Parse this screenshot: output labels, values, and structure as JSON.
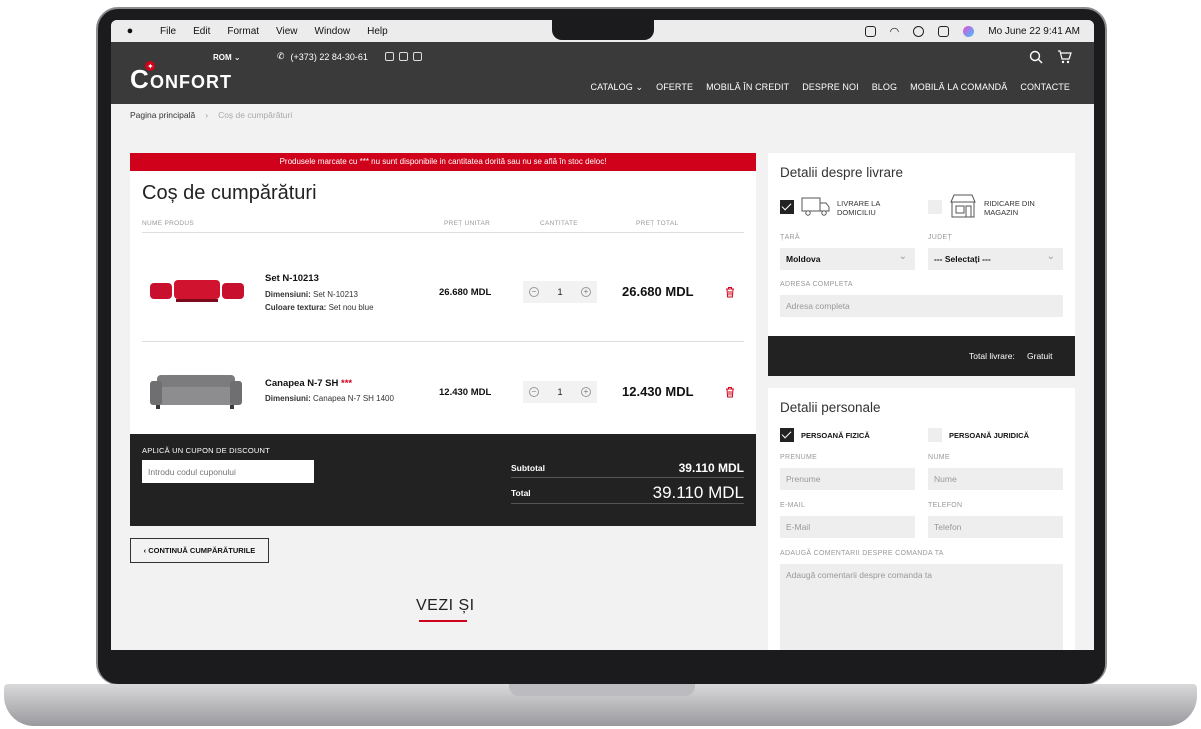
{
  "menubar": {
    "menus": [
      "File",
      "Edit",
      "Format",
      "View",
      "Window",
      "Help"
    ],
    "clock": "Mo June 22  9:41 AM"
  },
  "header": {
    "language": "ROM",
    "logo_text": "CONFORT",
    "phone": "(+373) 22 84-30-61",
    "nav": [
      "CATALOG",
      "OFERTE",
      "MOBILĂ ÎN CREDIT",
      "DESPRE NOI",
      "BLOG",
      "MOBILĂ LA COMANDĂ",
      "CONTACTE"
    ]
  },
  "breadcrumb": {
    "home": "Pagina principală",
    "current": "Coș de cumpărături"
  },
  "cart": {
    "alert": "Produsele marcate cu *** nu sunt disponibile in cantitatea dorită sau nu se află în stoc deloc!",
    "title": "Coș de cumpărături",
    "columns": {
      "product": "NUME PRODUS",
      "unit_price": "PREȚ UNITAR",
      "quantity": "CANTITATE",
      "total_price": "PREȚ TOTAL"
    },
    "items": [
      {
        "name": "Set N-10213",
        "stars": "",
        "dimensions_label": "Dimensiuni:",
        "dimensions": "Set N-10213",
        "color_label": "Culoare textura:",
        "color": "Set nou blue",
        "unit_price": "26.680 MDL",
        "quantity": "1",
        "total": "26.680 MDL"
      },
      {
        "name": "Canapea N-7 SH",
        "stars": "***",
        "dimensions_label": "Dimensiuni:",
        "dimensions": "Canapea N-7 SH 1400",
        "unit_price": "12.430 MDL",
        "quantity": "1",
        "total": "12.430 MDL"
      }
    ],
    "coupon_label": "APLICĂ UN CUPON DE DISCOUNT",
    "coupon_placeholder": "Introdu codul cuponului",
    "subtotal_label": "Subtotal",
    "subtotal": "39.110 MDL",
    "total_label": "Total",
    "total": "39.110 MDL",
    "continue_label": "‹ CONTINUĂ CUMPĂRĂTURILE",
    "see_also": "VEZI ȘI"
  },
  "delivery": {
    "title": "Detalii despre livrare",
    "home_delivery": "LIVRARE LA DOMICILIU",
    "pickup": "RIDICARE DIN MAGAZIN",
    "country_label": "ȚARĂ",
    "country_value": "Moldova",
    "district_label": "JUDEȚ",
    "district_value": "--- Selectați ---",
    "address_label": "ADRESA COMPLETA",
    "address_placeholder": "Adresa completa",
    "total_label": "Total livrare:",
    "total_value": "Gratuit"
  },
  "personal": {
    "title": "Detalii personale",
    "individual": "PERSOANĂ FIZICĂ",
    "legal": "PERSOANĂ JURIDICĂ",
    "firstname_label": "PRENUME",
    "firstname_placeholder": "Prenume",
    "lastname_label": "NUME",
    "lastname_placeholder": "Nume",
    "email_label": "E-MAIL",
    "email_placeholder": "E-Mail",
    "phone_label": "TELEFON",
    "phone_placeholder": "Telefon",
    "comment_label": "ADAUGĂ COMENTARII DESPRE COMANDA TA",
    "comment_placeholder": "Adaugă comentarii despre comanda ta"
  },
  "colors": {
    "accent": "#d0021b",
    "header_bg": "#3a3a3a",
    "dark_block": "#222222"
  }
}
